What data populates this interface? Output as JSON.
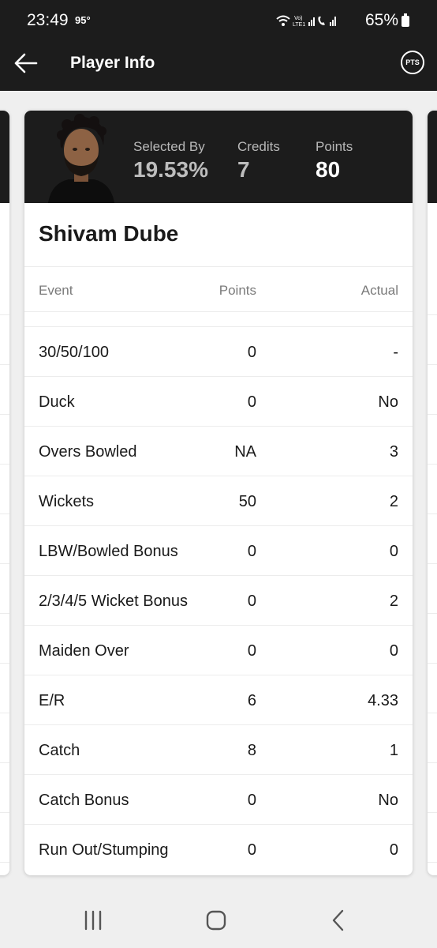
{
  "status_bar": {
    "time": "23:49",
    "temperature": "95°",
    "battery": "65%"
  },
  "app_bar": {
    "title": "Player Info",
    "pts_label": "PTS"
  },
  "player": {
    "name": "Shivam Dube",
    "stats": [
      {
        "label": "Selected By",
        "value": "19.53%"
      },
      {
        "label": "Credits",
        "value": "7"
      },
      {
        "label": "Points",
        "value": "80"
      }
    ]
  },
  "table": {
    "headers": {
      "event": "Event",
      "points": "Points",
      "actual": "Actual"
    },
    "rows": [
      {
        "event": "30/50/100",
        "points": "0",
        "actual": "-"
      },
      {
        "event": "Duck",
        "points": "0",
        "actual": "No"
      },
      {
        "event": "Overs Bowled",
        "points": "NA",
        "actual": "3"
      },
      {
        "event": "Wickets",
        "points": "50",
        "actual": "2"
      },
      {
        "event": "LBW/Bowled Bonus",
        "points": "0",
        "actual": "0"
      },
      {
        "event": "2/3/4/5 Wicket Bonus",
        "points": "0",
        "actual": "2"
      },
      {
        "event": "Maiden Over",
        "points": "0",
        "actual": "0"
      },
      {
        "event": "E/R",
        "points": "6",
        "actual": "4.33"
      },
      {
        "event": "Catch",
        "points": "8",
        "actual": "1"
      },
      {
        "event": "Catch Bonus",
        "points": "0",
        "actual": "No"
      },
      {
        "event": "Run Out/Stumping",
        "points": "0",
        "actual": "0"
      }
    ]
  },
  "icons": {
    "back": "arrow-left-icon",
    "pts": "pts-circle-icon",
    "nav_recents": "recents-icon",
    "nav_home": "home-icon",
    "nav_back": "chevron-left-icon"
  },
  "colors": {
    "header_bg": "#1c1c1c",
    "page_bg": "#efefef",
    "card_bg": "#ffffff",
    "muted_text": "#7a7a7a"
  }
}
